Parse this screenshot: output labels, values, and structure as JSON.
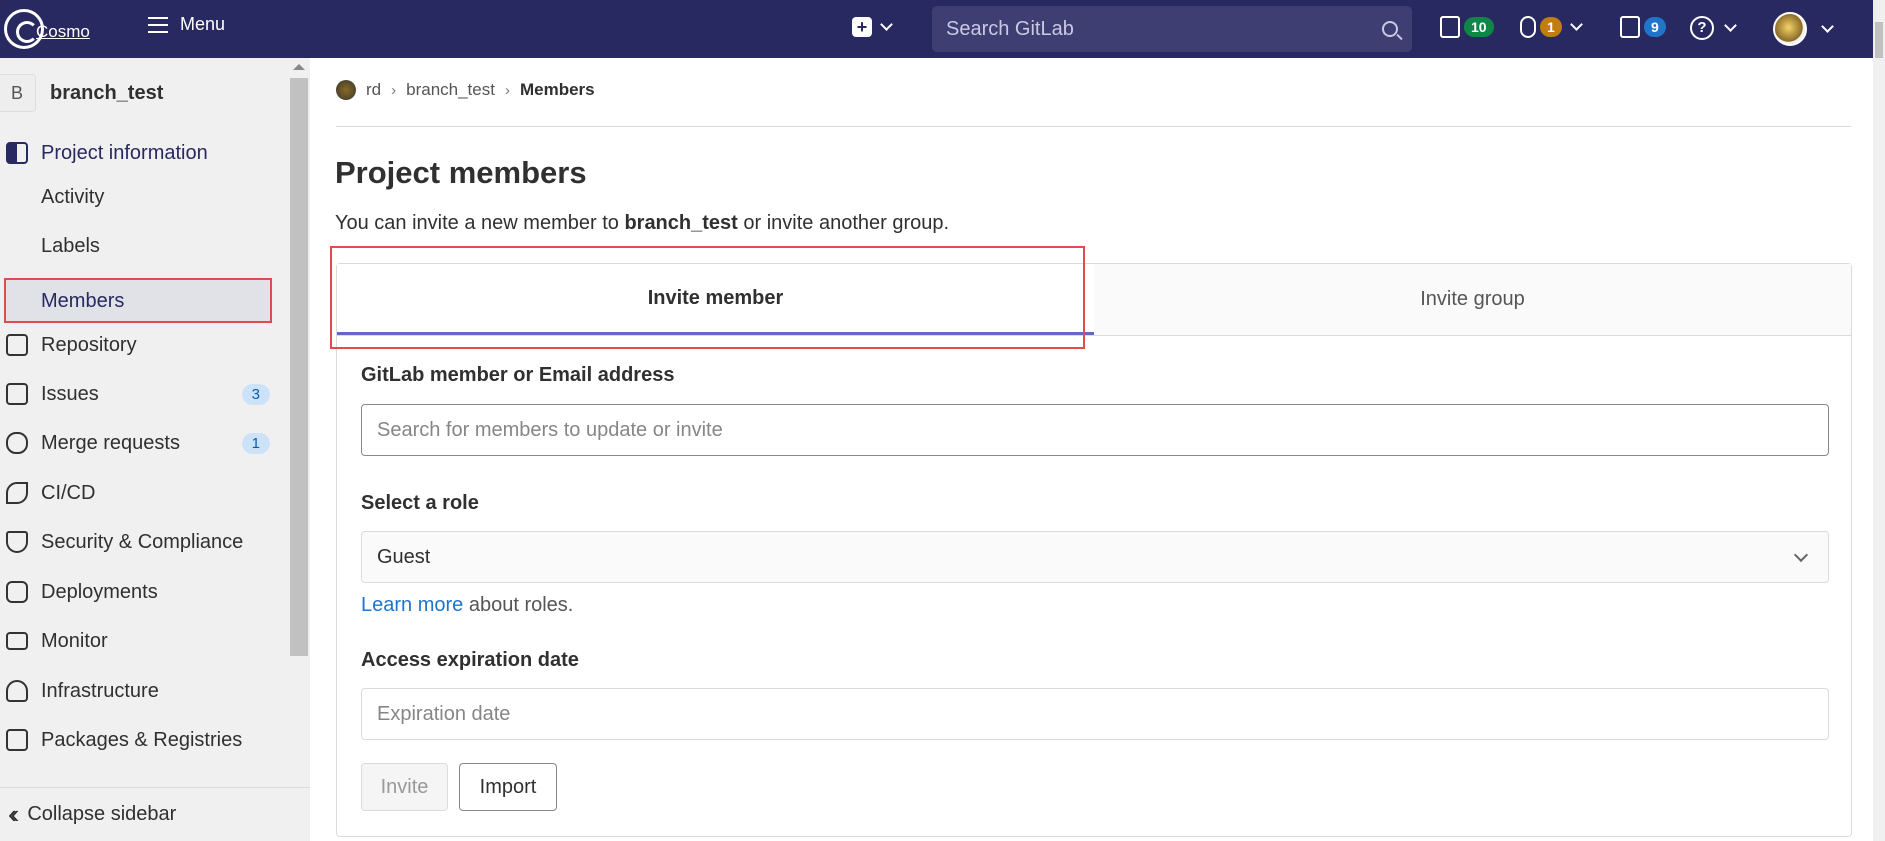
{
  "topbar": {
    "logo_text": "Cosmo",
    "menu_label": "Menu",
    "search_placeholder": "Search GitLab",
    "issues_count": "10",
    "mr_count": "1",
    "todo_count": "9",
    "help_label": "?"
  },
  "sidebar": {
    "project_initial": "B",
    "project_name": "branch_test",
    "items": {
      "project_information": "Project information",
      "activity": "Activity",
      "labels": "Labels",
      "members": "Members",
      "repository": "Repository",
      "issues": "Issues",
      "issues_count": "3",
      "merge_requests": "Merge requests",
      "merge_requests_count": "1",
      "cicd": "CI/CD",
      "security": "Security & Compliance",
      "deployments": "Deployments",
      "monitor": "Monitor",
      "infrastructure": "Infrastructure",
      "packages": "Packages & Registries"
    },
    "collapse_label": "Collapse sidebar"
  },
  "breadcrumb": {
    "user": "rd",
    "project": "branch_test",
    "current": "Members"
  },
  "main": {
    "title": "Project members",
    "desc_prefix": "You can invite a new member to ",
    "desc_project": "branch_test",
    "desc_suffix": " or invite another group.",
    "tabs": {
      "invite_member": "Invite member",
      "invite_group": "Invite group"
    },
    "form": {
      "member_label": "GitLab member or Email address",
      "member_placeholder": "Search for members to update or invite",
      "role_label": "Select a role",
      "role_value": "Guest",
      "learn_more": "Learn more",
      "about_roles": " about roles.",
      "expiration_label": "Access expiration date",
      "expiration_placeholder": "Expiration date",
      "invite_button": "Invite",
      "import_button": "Import"
    }
  },
  "colors": {
    "navbar": "#292961",
    "sidebar_bg": "#f0f0f0",
    "accent": "#6666c4",
    "link": "#1f75cb",
    "highlight": "#e04b4b"
  }
}
